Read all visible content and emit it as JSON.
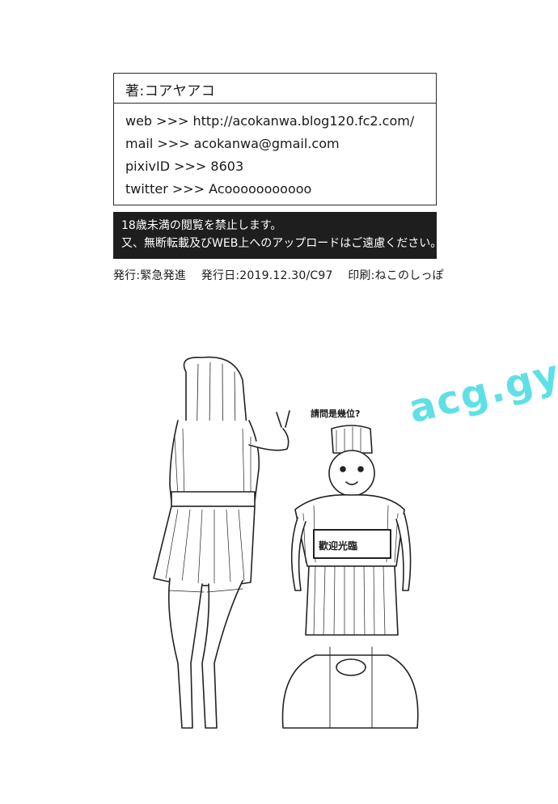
{
  "author": "著:コアヤアコ",
  "contacts": [
    "web >>> http://acokanwa.blog120.fc2.com/",
    "mail >>> acokanwa@gmail.com",
    "pixivID >>> 8603",
    "twitter >>> Acooooooooooo"
  ],
  "notice": [
    "18歳未満の閲覧を禁止します。",
    "又、無断転載及びWEB上へのアップロードはご遠慮ください。"
  ],
  "colophon": {
    "publisher": "発行:緊急発進",
    "date": "発行日:2019.12.30/C97",
    "printer": "印刷:ねこのしっぽ"
  },
  "illustration": {
    "speech_bubble": "請問是幾位?",
    "robot_sign": "歡迎光臨"
  },
  "watermark": "acg.gy"
}
